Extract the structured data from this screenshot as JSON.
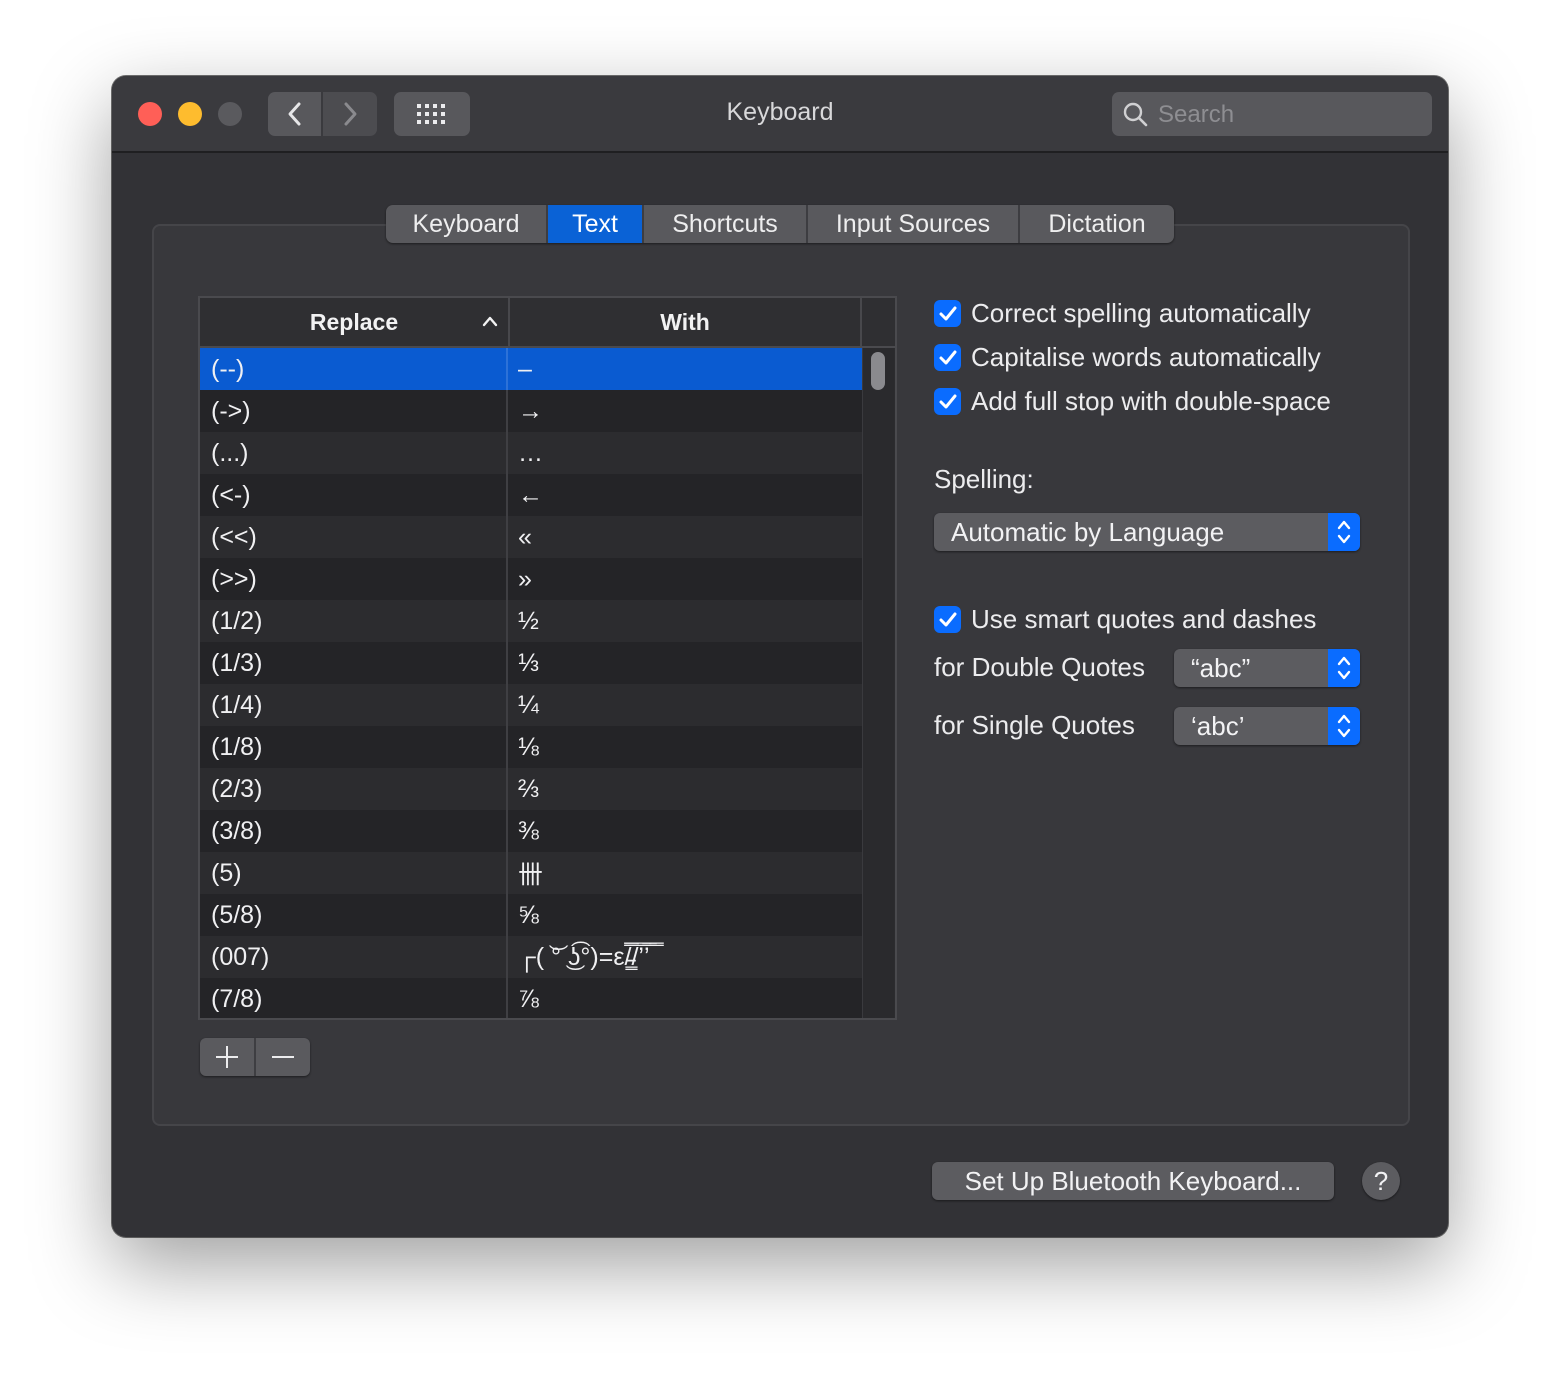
{
  "window": {
    "title": "Keyboard"
  },
  "search": {
    "placeholder": "Search"
  },
  "tabs": [
    {
      "label": "Keyboard",
      "active": false
    },
    {
      "label": "Text",
      "active": true
    },
    {
      "label": "Shortcuts",
      "active": false
    },
    {
      "label": "Input Sources",
      "active": false
    },
    {
      "label": "Dictation",
      "active": false
    }
  ],
  "table": {
    "headers": {
      "replace": "Replace",
      "with": "With"
    },
    "sort_column": "replace",
    "sort_direction": "ascending",
    "rows": [
      {
        "replace": "(--)",
        "with": "–",
        "selected": true
      },
      {
        "replace": "(->)",
        "with": "→"
      },
      {
        "replace": "(...)",
        "with": "…"
      },
      {
        "replace": "(<-)",
        "with": "←"
      },
      {
        "replace": "(<<)",
        "with": "«"
      },
      {
        "replace": "(>>)",
        "with": "»"
      },
      {
        "replace": "(1/2)",
        "with": "½"
      },
      {
        "replace": "(1/3)",
        "with": "⅓"
      },
      {
        "replace": "(1/4)",
        "with": "¼"
      },
      {
        "replace": "(1/8)",
        "with": "⅛"
      },
      {
        "replace": "(2/3)",
        "with": "⅔"
      },
      {
        "replace": "(3/8)",
        "with": "⅜"
      },
      {
        "replace": "(5)",
        "with": "卌"
      },
      {
        "replace": "(5/8)",
        "with": "⅝"
      },
      {
        "replace": "(007)",
        "with": "┌( ͝° ͜ʖ͡°)=ε/̵͇̿̿/’̿’̿ ̿"
      },
      {
        "replace": "(7/8)",
        "with": "⅞"
      }
    ]
  },
  "options": {
    "correct_spelling": {
      "label": "Correct spelling automatically",
      "checked": true
    },
    "capitalise_words": {
      "label": "Capitalise words automatically",
      "checked": true
    },
    "full_stop": {
      "label": "Add full stop with double-space",
      "checked": true
    },
    "spelling_label": "Spelling:",
    "spelling_value": "Automatic by Language",
    "smart_quotes": {
      "label": "Use smart quotes and dashes",
      "checked": true
    },
    "double_quotes_label": "for Double Quotes",
    "double_quotes_value": "“abc”",
    "single_quotes_label": "for Single Quotes",
    "single_quotes_value": "‘abc’"
  },
  "footer": {
    "bluetooth_label": "Set Up Bluetooth Keyboard...",
    "help_label": "?"
  },
  "colors": {
    "accent": "#0a6cff",
    "selection": "#0a5bd1",
    "window_bg": "#323236"
  },
  "icons": [
    "back-chevron-icon",
    "forward-chevron-icon",
    "grid-icon",
    "search-icon",
    "sort-ascending-icon",
    "checkmark-icon",
    "updown-chevron-icon",
    "plus-icon",
    "minus-icon"
  ]
}
